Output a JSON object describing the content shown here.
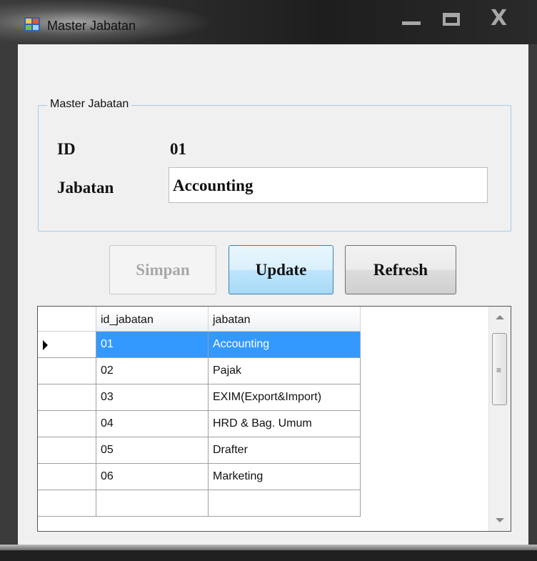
{
  "window": {
    "title": "Master Jabatan",
    "close_glyph": "X"
  },
  "groupbox": {
    "label": "Master Jabatan"
  },
  "form": {
    "id_label": "ID",
    "id_value": "01",
    "jabatan_label": "Jabatan",
    "jabatan_value": "Accounting"
  },
  "buttons": {
    "simpan": "Simpan",
    "update": "Update",
    "refresh": "Refresh"
  },
  "grid": {
    "columns": [
      "id_jabatan",
      "jabatan"
    ],
    "rows": [
      {
        "id": "01",
        "jabatan": "Accounting",
        "selected": true
      },
      {
        "id": "02",
        "jabatan": "Pajak",
        "selected": false
      },
      {
        "id": "03",
        "jabatan": "EXIM(Export&Import)",
        "selected": false
      },
      {
        "id": "04",
        "jabatan": "HRD & Bag. Umum",
        "selected": false
      },
      {
        "id": "05",
        "jabatan": "Drafter",
        "selected": false
      },
      {
        "id": "06",
        "jabatan": "Marketing",
        "selected": false
      }
    ]
  },
  "colors": {
    "selection": "#3399ff",
    "groupbox_border": "#a9cbe6",
    "client_bg": "#f0f0f0"
  },
  "icons": [
    "app-icon",
    "minimize-icon",
    "maximize-icon",
    "close-icon",
    "row-pointer-icon",
    "scroll-up-icon",
    "scroll-down-icon"
  ]
}
